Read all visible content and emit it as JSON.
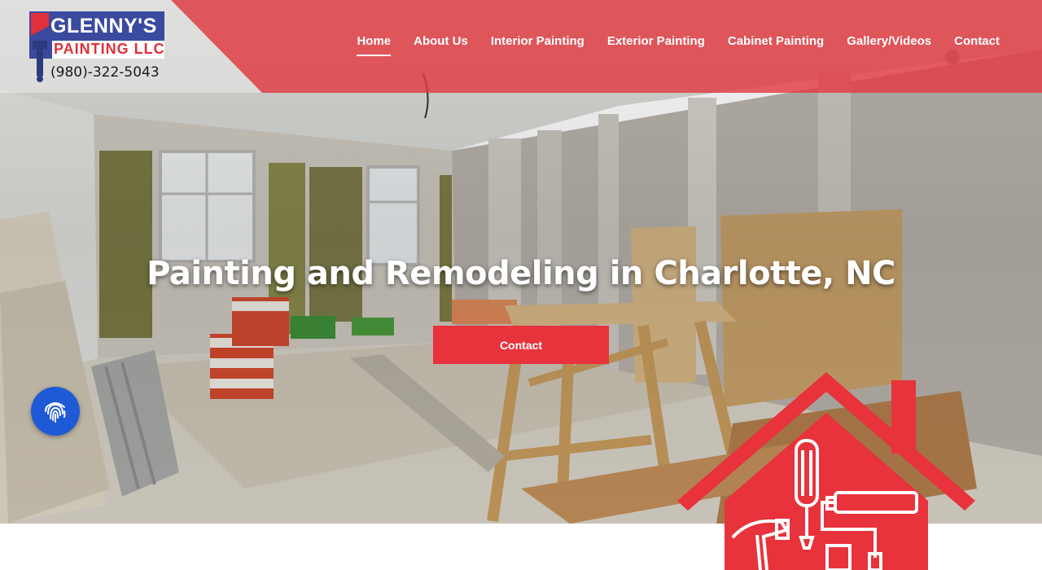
{
  "brand": {
    "name_top": "GLENNY'S",
    "name_bottom": "PAINTING LLC",
    "phone": "(980)-322-5043"
  },
  "nav": {
    "items": [
      {
        "label": "Home",
        "active": true
      },
      {
        "label": "About Us",
        "active": false
      },
      {
        "label": "Interior Painting",
        "active": false
      },
      {
        "label": "Exterior Painting",
        "active": false
      },
      {
        "label": "Cabinet Painting",
        "active": false
      },
      {
        "label": "Gallery/Videos",
        "active": false
      },
      {
        "label": "Contact",
        "active": false
      }
    ]
  },
  "hero": {
    "title": "Painting and Remodeling in Charlotte, NC",
    "cta_label": "Contact"
  },
  "icons": {
    "accessibility": "fingerprint-icon",
    "house_badge": "house-tools-icon",
    "logo_mark": "paintbrush-icon"
  },
  "colors": {
    "brand_red": "#e8323c",
    "brand_blue": "#3a4a9e",
    "accessibility_blue": "#1f5ad6"
  }
}
